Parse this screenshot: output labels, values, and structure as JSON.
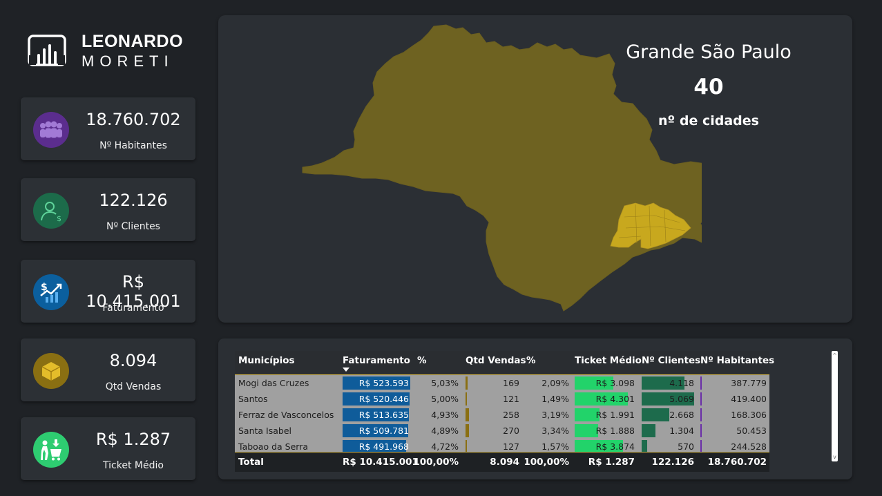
{
  "brand": {
    "line1": "LEONARDO",
    "line2": "MORETI"
  },
  "kpis": [
    {
      "value": "18.760.702",
      "label": "Nº Habitantes",
      "icon": "people-group-icon",
      "color": "#5b2d8e"
    },
    {
      "value": "122.126",
      "label": "Nº Clientes",
      "icon": "user-dollar-icon",
      "color": "#1c6b4a"
    },
    {
      "value": "R$ 10.415.001",
      "label": "Faturamento",
      "icon": "revenue-chart-icon",
      "color": "#0b5f9e"
    },
    {
      "value": "8.094",
      "label": "Qtd Vendas",
      "icon": "box-icon",
      "color": "#8a6f12"
    },
    {
      "value": "R$ 1.287",
      "label": "Ticket Médio",
      "icon": "shopping-cart-icon",
      "color": "#2ecc71"
    }
  ],
  "map": {
    "region": "Grande São Paulo",
    "count": "40",
    "count_label": "nº de cidades",
    "state_color": "#6e6221",
    "region_color": "#c8a81e"
  },
  "table": {
    "headers": {
      "municipio": "Municípios",
      "faturamento": "Faturamento",
      "fat_pct": "%",
      "qtd": "Qtd Vendas",
      "qtd_pct": "%",
      "ticket": "Ticket Médio",
      "clientes": "Nº Clientes",
      "habitantes": "Nº Habitantes"
    },
    "rows": [
      {
        "municipio": "Mogi das Cruzes",
        "faturamento": "R$ 523.593",
        "fat_pct": "5,03%",
        "qtd": "169",
        "qtd_pct": "2,09%",
        "ticket": "R$ 3.098",
        "clientes": "4.118",
        "habitantes": "387.779",
        "fat_ratio": 1.0,
        "qtd_ratio": 0.04,
        "ticket_ratio": 0.64,
        "clientes_ratio": 0.81,
        "hab_ratio": 0.018
      },
      {
        "municipio": "Santos",
        "faturamento": "R$ 520.446",
        "fat_pct": "5,00%",
        "qtd": "121",
        "qtd_pct": "1,49%",
        "ticket": "R$ 4.301",
        "clientes": "5.069",
        "habitantes": "419.400",
        "fat_ratio": 0.99,
        "qtd_ratio": 0.03,
        "ticket_ratio": 0.89,
        "clientes_ratio": 1.0,
        "hab_ratio": 0.02
      },
      {
        "municipio": "Ferraz de Vasconcelos",
        "faturamento": "R$ 513.635",
        "fat_pct": "4,93%",
        "qtd": "258",
        "qtd_pct": "3,19%",
        "ticket": "R$ 1.991",
        "clientes": "2.668",
        "habitantes": "168.306",
        "fat_ratio": 0.98,
        "qtd_ratio": 0.07,
        "ticket_ratio": 0.41,
        "clientes_ratio": 0.53,
        "hab_ratio": 0.008
      },
      {
        "municipio": "Santa Isabel",
        "faturamento": "R$ 509.781",
        "fat_pct": "4,89%",
        "qtd": "270",
        "qtd_pct": "3,34%",
        "ticket": "R$ 1.888",
        "clientes": "1.304",
        "habitantes": "50.453",
        "fat_ratio": 0.97,
        "qtd_ratio": 0.07,
        "ticket_ratio": 0.39,
        "clientes_ratio": 0.26,
        "hab_ratio": 0.003
      },
      {
        "municipio": "Taboao da Serra",
        "faturamento": "R$ 491.968",
        "fat_pct": "4,72%",
        "qtd": "127",
        "qtd_pct": "1,57%",
        "ticket": "R$ 3.874",
        "clientes": "570",
        "habitantes": "244.528",
        "fat_ratio": 0.94,
        "qtd_ratio": 0.03,
        "ticket_ratio": 0.8,
        "clientes_ratio": 0.11,
        "hab_ratio": 0.012
      }
    ],
    "total": {
      "label": "Total",
      "faturamento": "R$ 10.415.001",
      "fat_pct": "100,00%",
      "qtd": "8.094",
      "qtd_pct": "100,00%",
      "ticket": "R$ 1.287",
      "clientes": "122.126",
      "habitantes": "18.760.702"
    },
    "bar_colors": {
      "faturamento": "#0f5c9a",
      "qtd": "#8a6f12",
      "ticket": "#22d36a",
      "clientes": "#1d6b4c",
      "habitantes": "#6a2ea8"
    }
  }
}
